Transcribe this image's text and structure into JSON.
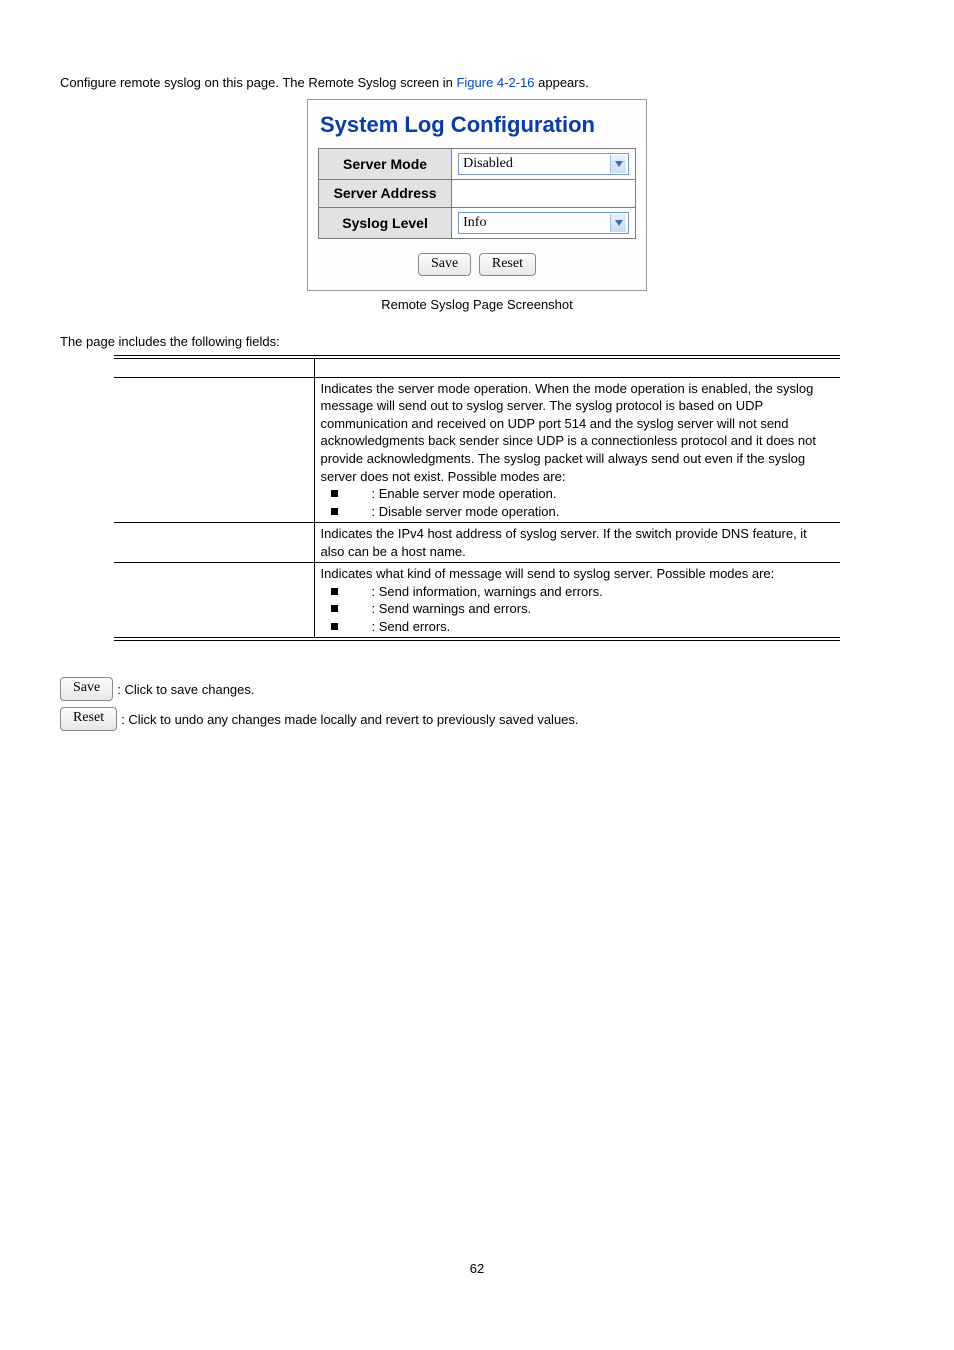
{
  "intro": {
    "before_link": "Configure remote syslog on this page. The Remote Syslog screen in ",
    "link_text": "Figure 4-2-16",
    "after_link": " appears."
  },
  "screenshot": {
    "title": "System Log Configuration",
    "rows": {
      "server_mode_label": "Server Mode",
      "server_mode_value": "Disabled",
      "server_address_label": "Server Address",
      "server_address_value": "",
      "syslog_level_label": "Syslog Level",
      "syslog_level_value": "Info"
    },
    "buttons": {
      "save": "Save",
      "reset": "Reset"
    },
    "caption": "Remote Syslog Page Screenshot"
  },
  "fields_intro": "The page includes the following fields:",
  "fields_table": {
    "header": {
      "object": "",
      "description": ""
    },
    "rows": [
      {
        "object": "",
        "desc_main": "Indicates the server mode operation. When the mode operation is enabled, the syslog message will send out to syslog server. The syslog protocol is based on UDP communication and received on UDP port 514 and the syslog server will not send acknowledgments back sender since UDP is a connectionless protocol and it does not provide acknowledgments. The syslog packet will always send out even if the syslog server does not exist. Possible modes are:",
        "bullets": [
          {
            "label": "",
            "text": ": Enable server mode operation."
          },
          {
            "label": "",
            "text": ": Disable server mode operation."
          }
        ]
      },
      {
        "object": "",
        "desc_main": "Indicates the IPv4 host address of syslog server. If the switch provide DNS feature, it also can be a host name.",
        "bullets": []
      },
      {
        "object": "",
        "desc_main": "Indicates what kind of message will send to syslog server. Possible modes are:",
        "bullets": [
          {
            "label": "",
            "text": ": Send information, warnings and errors."
          },
          {
            "label": "",
            "text": ": Send warnings and errors."
          },
          {
            "label": "",
            "text": ": Send errors."
          }
        ]
      }
    ]
  },
  "notes": {
    "save_btn": "Save",
    "save_text": ": Click to save changes.",
    "reset_btn": "Reset",
    "reset_text": ": Click to undo any changes made locally and revert to previously saved values."
  },
  "page_number": "62"
}
